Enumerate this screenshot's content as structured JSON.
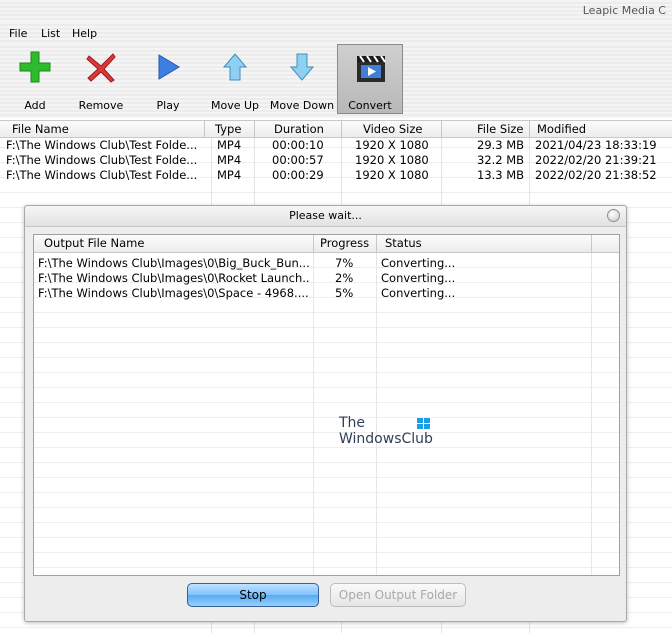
{
  "window": {
    "title": "Leapic Media C"
  },
  "menu": [
    "File",
    "List",
    "Help"
  ],
  "toolbar": {
    "add": "Add",
    "remove": "Remove",
    "play": "Play",
    "move_up": "Move Up",
    "move_down": "Move Down",
    "convert": "Convert"
  },
  "file_table": {
    "columns": [
      "File Name",
      "Type",
      "Duration",
      "Video Size",
      "File Size",
      "Modified"
    ],
    "rows": [
      {
        "name": "F:\\The Windows Club\\Test Folde...",
        "type": "MP4",
        "duration": "00:00:10",
        "video_size": "1920 X 1080",
        "file_size": "29.3 MB",
        "modified": "2021/04/23 18:33:19"
      },
      {
        "name": "F:\\The Windows Club\\Test Folde...",
        "type": "MP4",
        "duration": "00:00:57",
        "video_size": "1920 X 1080",
        "file_size": "32.2 MB",
        "modified": "2022/02/20 21:39:21"
      },
      {
        "name": "F:\\The Windows Club\\Test Folde...",
        "type": "MP4",
        "duration": "00:00:29",
        "video_size": "1920 X 1080",
        "file_size": "13.3 MB",
        "modified": "2022/02/20 21:38:52"
      }
    ]
  },
  "dialog": {
    "title": "Please wait...",
    "columns": [
      "Output File Name",
      "Progress",
      "Status"
    ],
    "rows": [
      {
        "name": "F:\\The Windows Club\\Images\\0\\Big_Buck_Bun...",
        "progress": "7%",
        "status": "Converting..."
      },
      {
        "name": "F:\\The Windows Club\\Images\\0\\Rocket Launch...",
        "progress": "2%",
        "status": "Converting..."
      },
      {
        "name": "F:\\The Windows Club\\Images\\0\\Space - 4968....",
        "progress": "5%",
        "status": "Converting..."
      }
    ],
    "stop_label": "Stop",
    "open_folder_label": "Open Output Folder"
  },
  "watermark": {
    "line1": "The",
    "line2": "WindowsClub"
  },
  "colors": {
    "accent_button": "#7ec2ff",
    "watermark": "#2f3e58",
    "logo": "#1f9ee8"
  }
}
